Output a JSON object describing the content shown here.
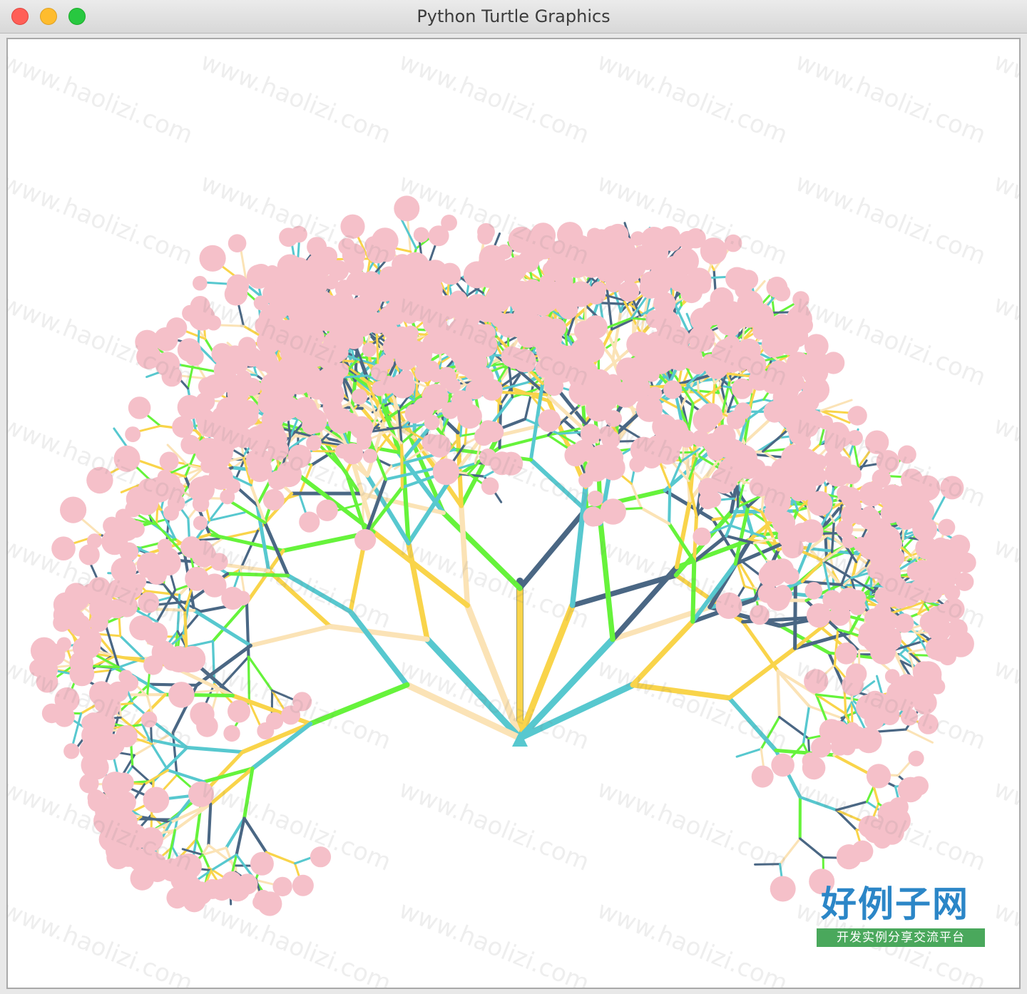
{
  "window": {
    "title": "Python Turtle Graphics",
    "controls": [
      "close",
      "minimize",
      "zoom"
    ]
  },
  "canvas": {
    "drawing": "fractal tree",
    "background": "#ffffff",
    "branch_colors": [
      "#4a6784",
      "#57c8cf",
      "#66f33b",
      "#f9d44a",
      "#fbe3b6"
    ],
    "blossom_color": "#f5c0c9",
    "turtle_cursor_color": "#57c8cf"
  },
  "watermark": {
    "text": "www.haolizi.com",
    "logo_main": "好例子网",
    "logo_sub": "开发实例分享交流平台"
  }
}
